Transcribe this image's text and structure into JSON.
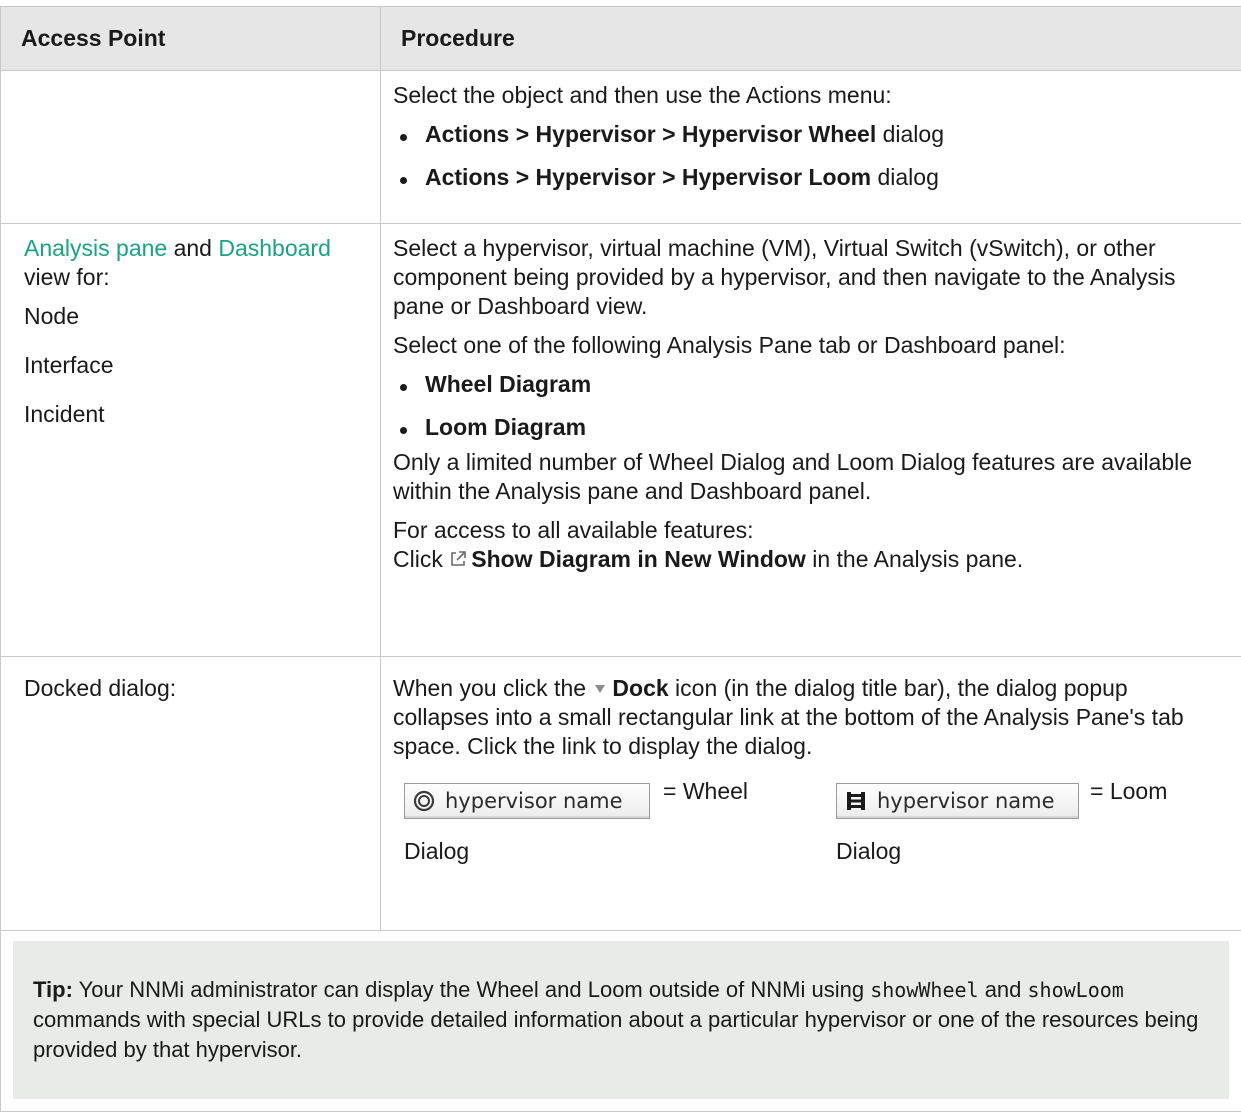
{
  "table": {
    "headers": [
      "Access Point",
      "Procedure"
    ],
    "row1": {
      "procedure_intro": "Select the object and then use the Actions menu:",
      "bullets": [
        {
          "bold": "Actions > Hypervisor > Hypervisor Wheel",
          "rest": " dialog"
        },
        {
          "bold": "Actions > Hypervisor > Hypervisor Loom",
          "rest": " dialog"
        }
      ]
    },
    "row2": {
      "access_link1": "Analysis pane",
      "access_and": " and ",
      "access_link2": "Dashboard",
      "access_tail": " view for:",
      "access_items": [
        "Node",
        "Interface",
        "Incident"
      ],
      "para1": "Select a hypervisor, virtual machine (VM), Virtual Switch (vSwitch), or other component being provided by a hypervisor, and then navigate to the Analysis pane or Dashboard view.",
      "para2": "Select one of the following Analysis Pane tab or Dashboard panel:",
      "bullets": [
        "Wheel Diagram",
        "Loom Diagram"
      ],
      "para3": "Only a limited number of Wheel Dialog and Loom Dialog features are available within the Analysis pane and Dashboard panel.",
      "para4": "For access to all available features:",
      "click_prefix": "Click ",
      "click_bold": "Show Diagram in New Window",
      "click_suffix": " in the Analysis pane.",
      "icon": "external-window-icon"
    },
    "row3": {
      "access": "Docked dialog:",
      "intro_prefix": "When you click the ",
      "intro_bold": "Dock",
      "intro_suffix": " icon (in the dialog title bar), the dialog popup collapses into a small rectangular link at the bottom of the Analysis Pane's tab space. Click the link to display the dialog.",
      "dock_icon": "dock-triangle-icon",
      "wheel_chip": "hypervisor name",
      "wheel_eq": "= Wheel",
      "wheel_caption": "Dialog",
      "loom_chip": "hypervisor name",
      "loom_eq": "= Loom",
      "loom_caption": "Dialog"
    }
  },
  "tip": {
    "label": "Tip:",
    "text1": " Your NNMi administrator can display the Wheel and Loom outside of NNMi using ",
    "code1": "showWheel",
    "text2": " and ",
    "code2": "showLoom",
    "text3": " commands with special URLs to provide detailed information about a particular hypervisor or one of the resources being provided by that hypervisor."
  }
}
